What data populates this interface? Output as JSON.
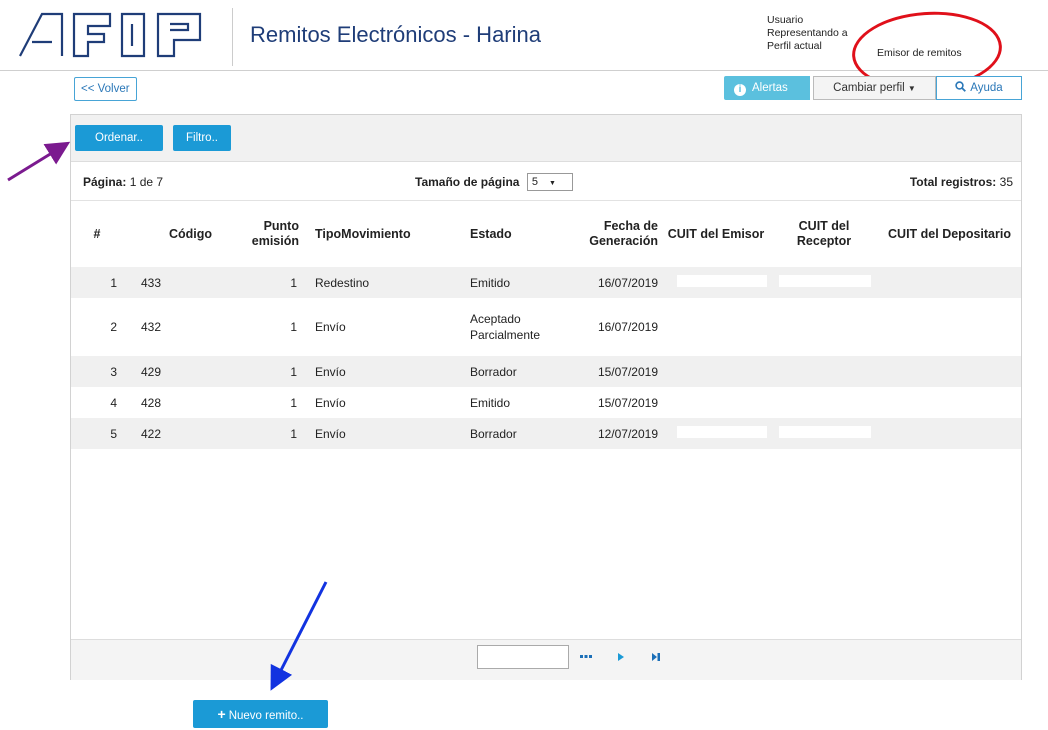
{
  "header": {
    "title": "Remitos Electrónicos - Harina",
    "usuario_label": "Usuario",
    "representando_label": "Representando a",
    "perfil_label": "Perfil actual",
    "perfil_value": "Emisor de remitos"
  },
  "toolbar": {
    "volver": "<< Volver",
    "alertas": "Alertas",
    "cambiar_perfil": "Cambiar perfil",
    "ayuda": "Ayuda",
    "ordenar": "Ordenar..",
    "filtro": "Filtro.."
  },
  "paging": {
    "pagina_label": "Página:",
    "pagina_value": "1 de 7",
    "tamano_label": "Tamaño de página",
    "tamano_value": "5",
    "total_label": "Total registros:",
    "total_value": "35"
  },
  "table": {
    "headers": [
      "#",
      "Código",
      "Punto emisión",
      "TipoMovimiento",
      "Estado",
      "Fecha de Generación",
      "CUIT del Emisor",
      "CUIT del Receptor",
      "CUIT del Depositario"
    ],
    "rows": [
      {
        "num": "1",
        "codigo": "433",
        "punto": "1",
        "tipo": "Redestino",
        "estado": "Emitido",
        "fecha": "16/07/2019"
      },
      {
        "num": "2",
        "codigo": "432",
        "punto": "1",
        "tipo": "Envío",
        "estado": "Aceptado Parcialmente",
        "fecha": "16/07/2019"
      },
      {
        "num": "3",
        "codigo": "429",
        "punto": "1",
        "tipo": "Envío",
        "estado": "Borrador",
        "fecha": "15/07/2019"
      },
      {
        "num": "4",
        "codigo": "428",
        "punto": "1",
        "tipo": "Envío",
        "estado": "Emitido",
        "fecha": "15/07/2019"
      },
      {
        "num": "5",
        "codigo": "422",
        "punto": "1",
        "tipo": "Envío",
        "estado": "Borrador",
        "fecha": "12/07/2019"
      }
    ]
  },
  "footer": {
    "nuevo_remito": "Nuevo remito.."
  },
  "icons": [
    "afip-logo",
    "info-icon",
    "caret-down-icon",
    "search-icon",
    "ellipsis-icon",
    "next-page-icon",
    "last-page-icon",
    "plus-icon"
  ],
  "colors": {
    "primary": "#1b9ad6",
    "info": "#5bc0de",
    "title": "#1f3d78",
    "annotation_red": "#e0101a",
    "annotation_purple": "#7b1a8f",
    "annotation_blue": "#1233e0"
  }
}
